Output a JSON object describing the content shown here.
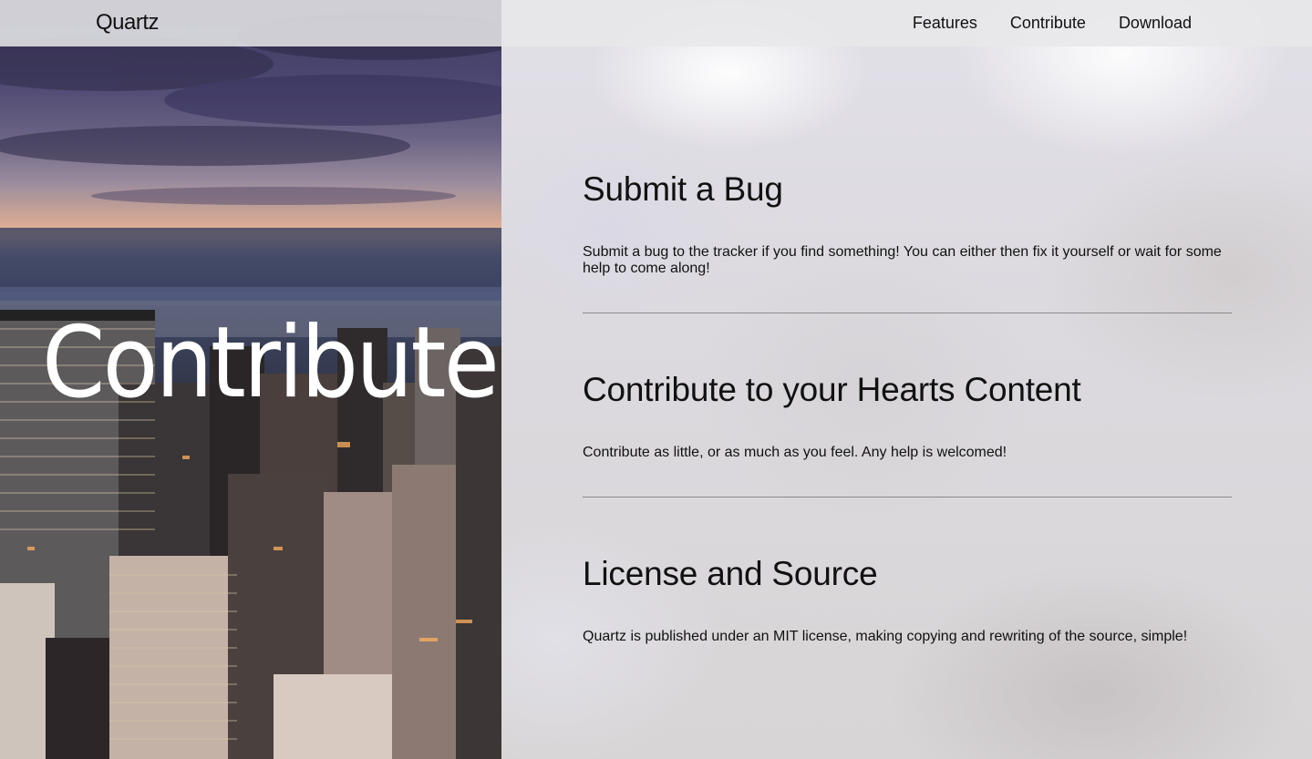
{
  "navbar": {
    "brand": "Quartz",
    "links": [
      "Features",
      "Contribute",
      "Download"
    ]
  },
  "hero": {
    "title": "Contribute"
  },
  "sections": [
    {
      "heading": "Submit a Bug",
      "body": "Submit a bug to the tracker if you find something! You can either then fix it yourself or wait for some help to come along!"
    },
    {
      "heading": "Contribute to your Hearts Content",
      "body": "Contribute as little, or as much as you feel. Any help is welcomed!"
    },
    {
      "heading": "License and Source",
      "body": "Quartz is published under an MIT license, making copying and rewriting of the source, simple!"
    }
  ]
}
